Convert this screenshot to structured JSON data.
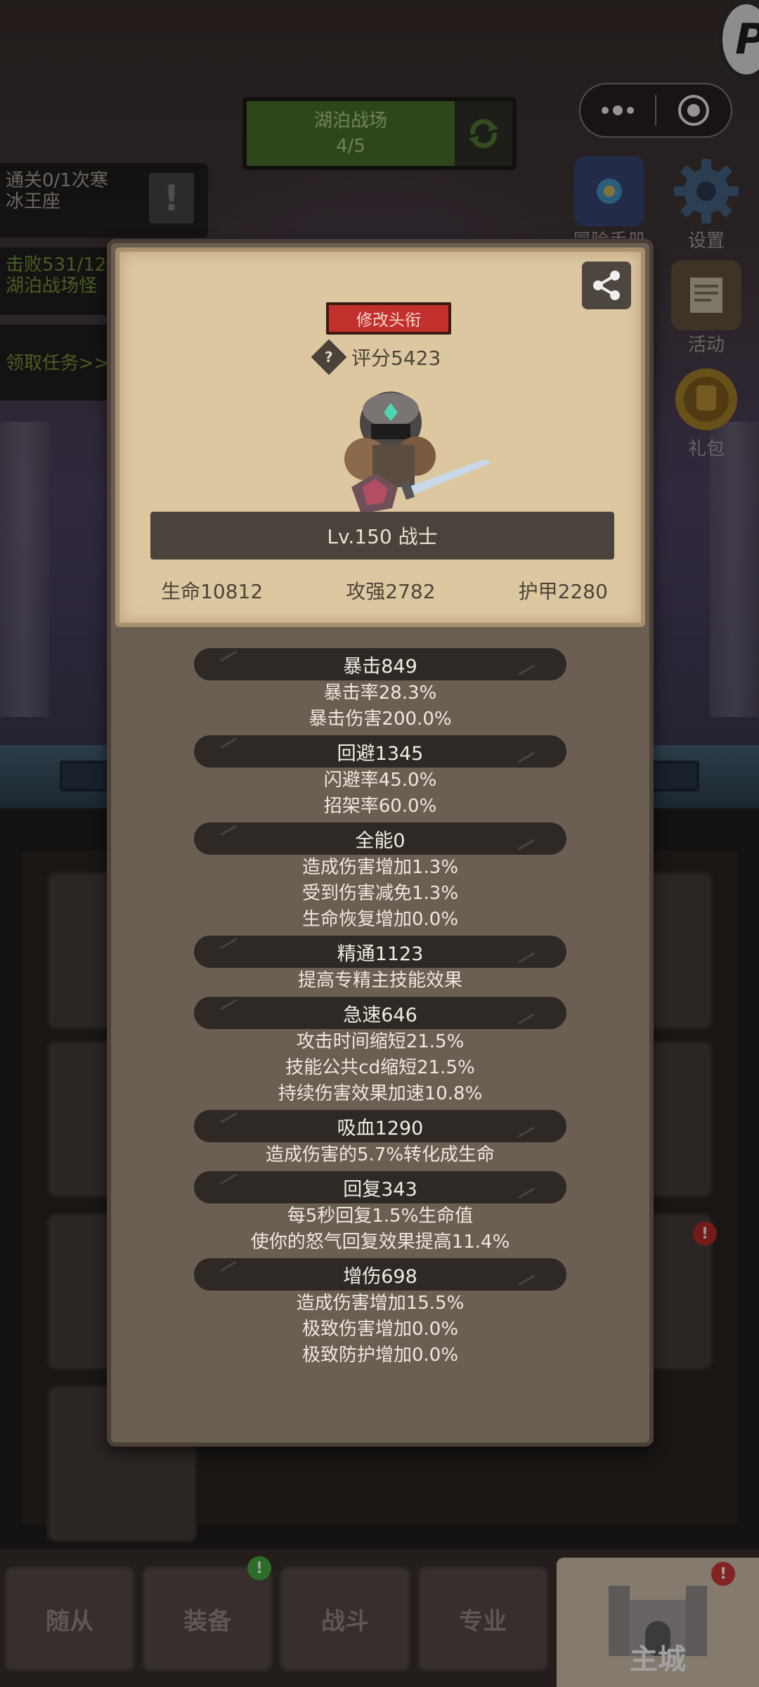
{
  "hud": {
    "battlefield_name": "湖泊战场",
    "battlefield_progress": "4/5",
    "quests": [
      {
        "line1": "通关0/1次寒",
        "line2": "冰王座"
      },
      {
        "line1": "击败531/12",
        "line2": "湖泊战场怪"
      },
      {
        "line1": "领取任务>>",
        "line2": ""
      }
    ],
    "side_buttons": [
      {
        "label": "冒险手册",
        "icon": "book-icon"
      },
      {
        "label": "设置",
        "icon": "gear-icon"
      },
      {
        "label": "活动",
        "icon": "scroll-icon"
      },
      {
        "label": "礼包",
        "icon": "giftbag-icon"
      }
    ],
    "corner_letter": "P"
  },
  "panel": {
    "title_button": "修改头衔",
    "score": "评分5423",
    "level_class": "Lv.150 战士",
    "base_stats": [
      "生命10812",
      "攻强2782",
      "护甲2280"
    ],
    "stat_groups": [
      {
        "head": "暴击849",
        "lines": [
          "暴击率28.3%",
          "暴击伤害200.0%"
        ]
      },
      {
        "head": "回避1345",
        "lines": [
          "闪避率45.0%",
          "招架率60.0%"
        ]
      },
      {
        "head": "全能0",
        "lines": [
          "造成伤害增加1.3%",
          "受到伤害减免1.3%",
          "生命恢复增加0.0%"
        ]
      },
      {
        "head": "精通1123",
        "lines": [
          "提高专精主技能效果"
        ]
      },
      {
        "head": "急速646",
        "lines": [
          "攻击时间缩短21.5%",
          "技能公共cd缩短21.5%",
          "持续伤害效果加速10.8%"
        ]
      },
      {
        "head": "吸血1290",
        "lines": [
          "造成伤害的5.7%转化成生命"
        ]
      },
      {
        "head": "回复343",
        "lines": [
          "每5秒回复1.5%生命值",
          "使你的怒气回复效果提高11.4%"
        ]
      },
      {
        "head": "增伤698",
        "lines": [
          "造成伤害增加15.5%",
          "极致伤害增加0.0%",
          "极致防护增加0.0%"
        ]
      }
    ]
  },
  "nav": {
    "tabs": [
      "随从",
      "装备",
      "战斗",
      "专业"
    ],
    "main": "主城"
  },
  "colors": {
    "parchment": "#dcc7a1",
    "panel": "#6b5f54",
    "title_button": "#c2302d",
    "battlefield_green": "#4f7b2e"
  }
}
